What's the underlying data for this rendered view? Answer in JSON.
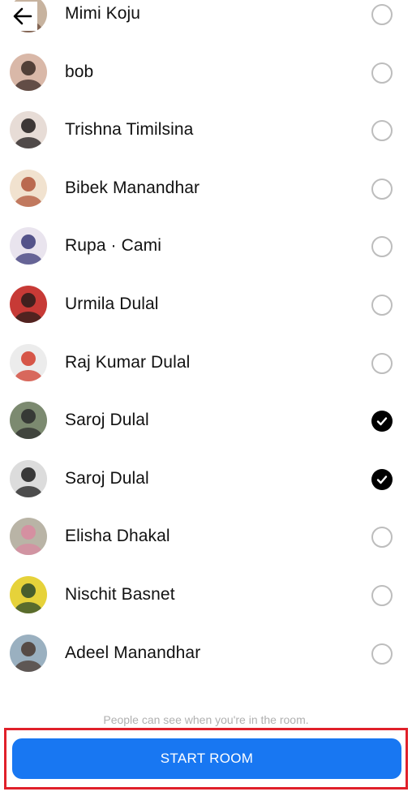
{
  "header": {
    "back_icon": "arrow-left-icon"
  },
  "contacts": [
    {
      "name": "Mimi Koju",
      "selected": false,
      "avatar_colors": [
        "#c7b39f",
        "#6b4a3a"
      ]
    },
    {
      "name": "bob",
      "selected": false,
      "avatar_colors": [
        "#d9b8a8",
        "#3a2a25"
      ]
    },
    {
      "name": "Trishna Timilsina",
      "selected": false,
      "avatar_colors": [
        "#e7dcd6",
        "#1e1a1a"
      ]
    },
    {
      "name": "Bibek Manandhar",
      "selected": false,
      "avatar_colors": [
        "#f1e2cf",
        "#b0553a"
      ]
    },
    {
      "name": "Rupa · Cami",
      "selected": false,
      "avatar_colors": [
        "#e9e4ee",
        "#3a3a78"
      ]
    },
    {
      "name": "Urmila Dulal",
      "selected": false,
      "avatar_colors": [
        "#c73a36",
        "#2a1c1a"
      ]
    },
    {
      "name": "Raj Kumar Dulal",
      "selected": false,
      "avatar_colors": [
        "#ececec",
        "#d23c2c"
      ]
    },
    {
      "name": "Saroj Dulal",
      "selected": true,
      "avatar_colors": [
        "#7c8a70",
        "#2c2c2c"
      ]
    },
    {
      "name": "Saroj Dulal",
      "selected": true,
      "avatar_colors": [
        "#dcdcdc",
        "#1c1c1c"
      ]
    },
    {
      "name": "Elisha Dhakal",
      "selected": false,
      "avatar_colors": [
        "#b9b4a6",
        "#d98aa0"
      ]
    },
    {
      "name": "Nischit Basnet",
      "selected": false,
      "avatar_colors": [
        "#e6d23a",
        "#2b4a2a"
      ]
    },
    {
      "name": "Adeel Manandhar",
      "selected": false,
      "avatar_colors": [
        "#9ab0c0",
        "#4a3a30"
      ]
    }
  ],
  "footer": {
    "note": "People can see when you're in the room.",
    "start_label": "START ROOM"
  },
  "colors": {
    "accent": "#1877f2",
    "highlight_border": "#e0202a",
    "check_selected": "#000000",
    "check_unselected_border": "#bdbdbd",
    "note_text": "#b0b0b0"
  }
}
